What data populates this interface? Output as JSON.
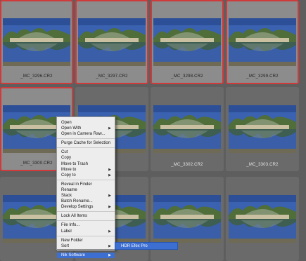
{
  "thumbnails": [
    {
      "caption": "_MC_3296.CR2",
      "selected": true
    },
    {
      "caption": "_MC_3297.CR2",
      "selected": true
    },
    {
      "caption": "_MC_3298.CR2",
      "selected": true
    },
    {
      "caption": "_MC_3299.CR2",
      "selected": true
    },
    {
      "caption": "_MC_3300.CR2",
      "selected": true
    },
    {
      "caption": "",
      "selected": false
    },
    {
      "caption": "_MC_3302.CR2",
      "selected": false
    },
    {
      "caption": "_MC_3303.CR2",
      "selected": false
    },
    {
      "caption": "",
      "selected": false
    },
    {
      "caption": "",
      "selected": false
    },
    {
      "caption": "",
      "selected": false
    },
    {
      "caption": "",
      "selected": false
    }
  ],
  "context_menu": {
    "items": [
      {
        "label": "Open",
        "submenu": false
      },
      {
        "label": "Open With",
        "submenu": true
      },
      {
        "label": "Open in Camera Raw...",
        "submenu": false
      },
      {
        "sep": true
      },
      {
        "label": "Purge Cache for Selection",
        "submenu": false
      },
      {
        "sep": true
      },
      {
        "label": "Cut",
        "submenu": false
      },
      {
        "label": "Copy",
        "submenu": false
      },
      {
        "label": "Move to Trash",
        "submenu": false
      },
      {
        "label": "Move to",
        "submenu": true
      },
      {
        "label": "Copy to",
        "submenu": true
      },
      {
        "sep": true
      },
      {
        "label": "Reveal in Finder",
        "submenu": false
      },
      {
        "label": "Rename",
        "submenu": false
      },
      {
        "label": "Stack",
        "submenu": true
      },
      {
        "label": "Batch Rename...",
        "submenu": false
      },
      {
        "label": "Develop Settings",
        "submenu": true
      },
      {
        "sep": true
      },
      {
        "label": "Lock All Items",
        "submenu": false
      },
      {
        "sep": true
      },
      {
        "label": "File Info...",
        "submenu": false
      },
      {
        "label": "Label",
        "submenu": true
      },
      {
        "sep": true
      },
      {
        "label": "New Folder",
        "submenu": false
      },
      {
        "label": "Sort",
        "submenu": true
      },
      {
        "sep": true
      },
      {
        "label": "Nik Software",
        "submenu": true,
        "highlighted": true
      }
    ]
  },
  "submenu": {
    "label": "HDR Efex Pro"
  },
  "colors": {
    "selection_border": "#d13a3a",
    "menu_highlight": "#3d6fd2"
  }
}
